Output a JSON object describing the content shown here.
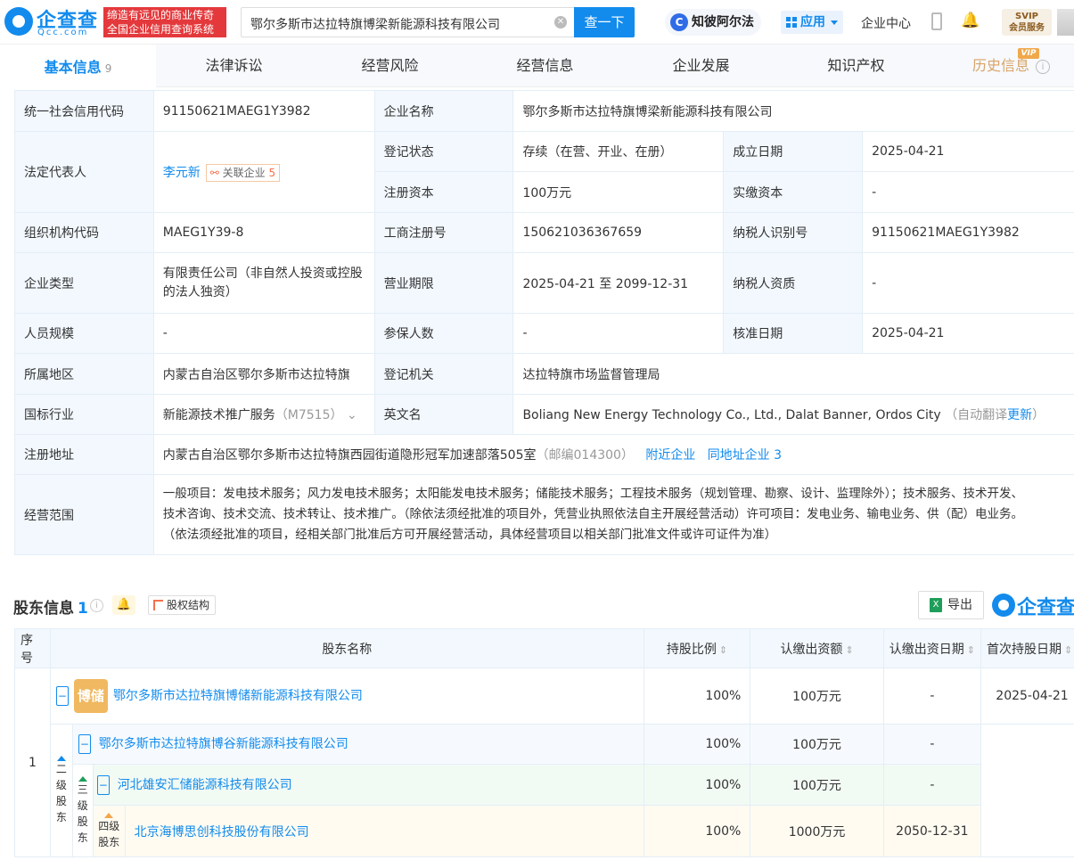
{
  "header": {
    "logo_cn": "企查查",
    "logo_en": "Qcc.com",
    "slogan_1": "缔造有远见的商业传奇",
    "slogan_2": "全国企业信用查询系统",
    "search_value": "鄂尔多斯市达拉特旗博梁新能源科技有限公司",
    "search_button": "查一下",
    "zhibi": "知彼阿尔法",
    "apps": "应用",
    "enterprise_center": "企业中心",
    "svip_line1": "SVIP",
    "svip_line2": "会员服务"
  },
  "tabs": [
    {
      "label": "基本信息",
      "count": "9"
    },
    {
      "label": "法律诉讼"
    },
    {
      "label": "经营风险"
    },
    {
      "label": "经营信息"
    },
    {
      "label": "企业发展"
    },
    {
      "label": "知识产权"
    },
    {
      "label": "历史信息",
      "badge": "VIP"
    }
  ],
  "info": {
    "credit_code_label": "统一社会信用代码",
    "credit_code": "91150621MAEG1Y3982",
    "name_label": "企业名称",
    "name": "鄂尔多斯市达拉特旗博梁新能源科技有限公司",
    "legal_rep_label": "法定代表人",
    "legal_rep": "李元新",
    "related_label": "关联企业",
    "related_count": "5",
    "status_label": "登记状态",
    "status": "存续（在营、开业、在册）",
    "founded_label": "成立日期",
    "founded": "2025-04-21",
    "reg_capital_label": "注册资本",
    "reg_capital": "100万元",
    "paid_capital_label": "实缴资本",
    "paid_capital": "-",
    "org_code_label": "组织机构代码",
    "org_code": "MAEG1Y39-8",
    "biz_reg_no_label": "工商注册号",
    "biz_reg_no": "150621036367659",
    "taxpayer_id_label": "纳税人识别号",
    "taxpayer_id": "91150621MAEG1Y3982",
    "type_label": "企业类型",
    "type_1": "有限责任公司（非自然人投资或控股",
    "type_2": "的法人独资）",
    "term_label": "营业期限",
    "term": "2025-04-21 至 2099-12-31",
    "taxpayer_qual_label": "纳税人资质",
    "taxpayer_qual": "-",
    "staff_label": "人员规模",
    "staff": "-",
    "insured_label": "参保人数",
    "insured": "-",
    "approved_label": "核准日期",
    "approved": "2025-04-21",
    "region_label": "所属地区",
    "region": "内蒙古自治区鄂尔多斯市达拉特旗",
    "authority_label": "登记机关",
    "authority": "达拉特旗市场监督管理局",
    "industry_label": "国标行业",
    "industry": "新能源技术推广服务",
    "industry_code": "（M7515）",
    "english_label": "英文名",
    "english": "Boliang New Energy Technology Co., Ltd., Dalat Banner, Ordos City",
    "auto_translate": "（自动翻译",
    "update": "更新",
    "close_paren": "）",
    "address_label": "注册地址",
    "address": "内蒙古自治区鄂尔多斯市达拉特旗西园街道隐形冠军加速部落505室",
    "postcode": "（邮编014300）",
    "nearby": "附近企业",
    "same_address": "同地址企业 3",
    "scope_label": "经营范围",
    "scope_1": "一般项目：发电技术服务；风力发电技术服务；太阳能发电技术服务；储能技术服务；工程技术服务（规划管理、勘察、设计、监理除外）；技术服务、技术开发、",
    "scope_2": "技术咨询、技术交流、技术转让、技术推广。（除依法须经批准的项目外，凭营业执照依法自主开展经营活动）许可项目：发电业务、输电业务、供（配）电业务。",
    "scope_3": "（依法须经批准的项目，经相关部门批准后方可开展经营活动，具体经营项目以相关部门批准文件或许可证件为准）"
  },
  "shareholders": {
    "title": "股东信息",
    "count": "1",
    "structure_btn": "股权结构",
    "export_btn": "导出",
    "logo_text": "企查查",
    "columns": {
      "index": "序号",
      "name": "股东名称",
      "ratio": "持股比例",
      "amount": "认缴出资额",
      "date": "认缴出资日期",
      "first_date": "首次持股日期"
    },
    "row_index": "1",
    "avatar_text": "博储",
    "level2_label": [
      "二",
      "级",
      "股",
      "东"
    ],
    "level3_label": [
      "三",
      "级",
      "股",
      "东"
    ],
    "level4_label": [
      "四级",
      "股东"
    ],
    "rows": [
      {
        "name": "鄂尔多斯市达拉特旗博储新能源科技有限公司",
        "ratio": "100%",
        "amount": "100万元",
        "date": "-",
        "first": "2025-04-21"
      },
      {
        "name": "鄂尔多斯市达拉特旗博谷新能源科技有限公司",
        "ratio": "100%",
        "amount": "100万元",
        "date": "-"
      },
      {
        "name": "河北雄安汇储能源科技有限公司",
        "ratio": "100%",
        "amount": "100万元",
        "date": "-"
      },
      {
        "name": "北京海博思创科技股份有限公司",
        "ratio": "100%",
        "amount": "1000万元",
        "date": "2050-12-31"
      }
    ]
  }
}
